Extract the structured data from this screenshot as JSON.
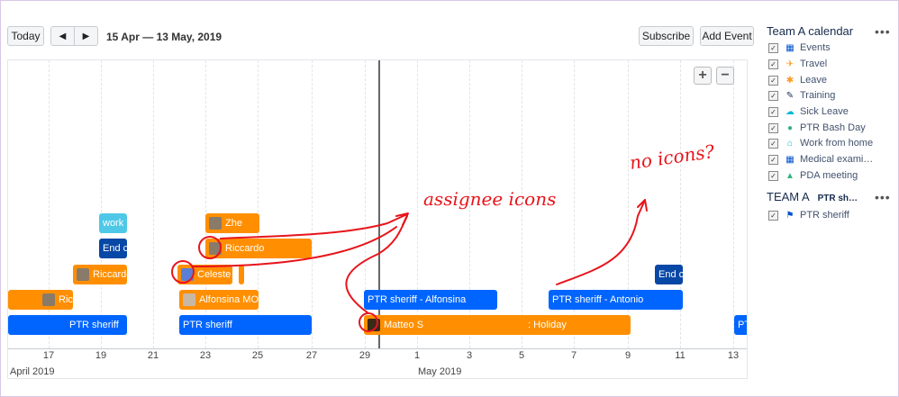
{
  "toolbar": {
    "today_label": "Today",
    "prev_glyph": "◀",
    "next_glyph": "▶",
    "date_range": "15 Apr — 13 May, 2019",
    "subscribe_label": "Subscribe",
    "add_event_label": "Add Event"
  },
  "timeline": {
    "ticks": [
      "17",
      "19",
      "21",
      "23",
      "25",
      "27",
      "29",
      "May 1",
      "3",
      "5",
      "7",
      "9",
      "11",
      "13"
    ],
    "month_april": "April 2019",
    "month_may": "May 2019",
    "tick_labels": [
      "17",
      "19",
      "21",
      "23",
      "25",
      "27",
      "29",
      "1",
      "3",
      "5",
      "7",
      "9",
      "11",
      "13"
    ]
  },
  "events": [
    {
      "label": "work",
      "color": "cyan"
    },
    {
      "label": "End c",
      "color": "dblue"
    },
    {
      "label": "Riccardo",
      "color": "orange"
    },
    {
      "label": "Ric",
      "color": "orange"
    },
    {
      "label": "PTR sheriff",
      "color": "blue"
    },
    {
      "label": "Zhe",
      "color": "orange"
    },
    {
      "label": "Riccardo",
      "color": "orange"
    },
    {
      "label": "Celeste",
      "color": "orange"
    },
    {
      "label": "Alfonsina MOS",
      "color": "orange"
    },
    {
      "label": "PTR sheriff",
      "color": "blue"
    },
    {
      "label": "PTR sheriff - Alfonsina",
      "color": "blue"
    },
    {
      "label": "Matteo S",
      "color": "orange"
    },
    {
      "label": ": Holiday",
      "color": "orange"
    },
    {
      "label": "PTR sheriff - Antonio",
      "color": "blue"
    },
    {
      "label": "End c",
      "color": "dblue"
    },
    {
      "label": "PTR",
      "color": "blue"
    }
  ],
  "sidebar": {
    "calendar_title": "Team A calendar",
    "more_glyph": "•••",
    "items": [
      {
        "label": "Events",
        "icon": "calendar-icon",
        "color": "#0052cc"
      },
      {
        "label": "Travel",
        "icon": "plane-icon",
        "color": "#ff991f"
      },
      {
        "label": "Leave",
        "icon": "palm-tree-icon",
        "color": "#ff991f"
      },
      {
        "label": "Training",
        "icon": "pen-icon",
        "color": "#172b4d"
      },
      {
        "label": "Sick Leave",
        "icon": "cloud-icon",
        "color": "#00b8d9"
      },
      {
        "label": "PTR Bash Day",
        "icon": "people-icon",
        "color": "#36b37e"
      },
      {
        "label": "Work from home",
        "icon": "home-icon",
        "color": "#00b8d9"
      },
      {
        "label": "Medical exami…",
        "icon": "calendar-icon",
        "color": "#0052cc"
      },
      {
        "label": "PDA meeting",
        "icon": "graduation-cap-icon",
        "color": "#36b37e"
      }
    ],
    "team_title": "TEAM A",
    "team_sub": "PTR sh…",
    "team_items": [
      {
        "label": "PTR sheriff",
        "icon": "flag-icon",
        "color": "#0052cc"
      }
    ]
  },
  "annotations": {
    "note_1": "assignee icons",
    "note_2": "no icons?"
  }
}
